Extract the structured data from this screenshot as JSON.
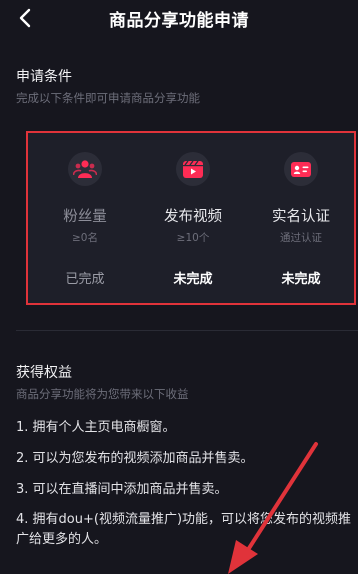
{
  "header": {
    "title": "商品分享功能申请",
    "back_icon": "chevron-left-icon"
  },
  "conditions_section": {
    "title": "申请条件",
    "subtitle": "完成以下条件即可申请商品分享功能"
  },
  "conditions": [
    {
      "icon": "fans-icon",
      "name": "粉丝量",
      "requirement": "≥0名",
      "status": "已完成",
      "completed": true
    },
    {
      "icon": "video-icon",
      "name": "发布视频",
      "requirement": "≥10个",
      "status": "未完成",
      "completed": false
    },
    {
      "icon": "id-card-icon",
      "name": "实名认证",
      "requirement": "通过认证",
      "status": "未完成",
      "completed": false
    }
  ],
  "benefits_section": {
    "title": "获得权益",
    "subtitle": "商品分享功能将为您带来以下收益",
    "items": [
      "1. 拥有个人主页电商橱窗。",
      "2. 可以为您发布的视频添加商品并售卖。",
      "3. 可以在直播间中添加商品并售卖。",
      "4. 拥有dou+(视频流量推广)功能，可以将您发布的视频推广给更多的人。"
    ]
  },
  "colors": {
    "background": "#16161e",
    "card": "#1e1f29",
    "highlight_border": "#e0333a",
    "icon_accent": "#fe2c55",
    "muted_text": "#6d6e7a"
  }
}
